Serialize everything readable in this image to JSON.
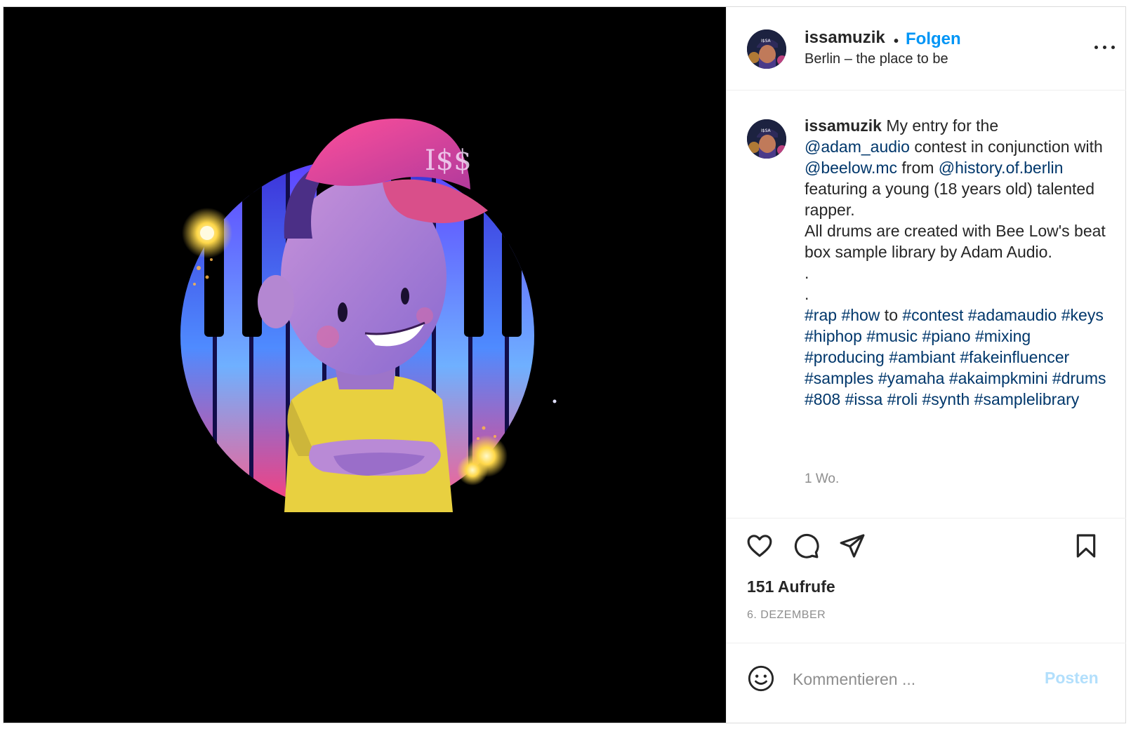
{
  "header": {
    "username": "issamuzik",
    "separator": "•",
    "follow_label": "Folgen",
    "location": "Berlin – the place to be",
    "more_icon": "more-horizontal-icon"
  },
  "caption": {
    "username": "issamuzik",
    "seg1": " My entry for the ",
    "mention1": "@adam_audio",
    "seg2": " contest in conjunction with ",
    "mention2": "@beelow.mc",
    "seg3": " from ",
    "mention3": "@history.of.berlin",
    "seg4": " featuring a young (18 years old) talented rapper.",
    "line2": "All drums are created with Bee Low's beat box sample library by Adam Audio.",
    "dot1": ".",
    "dot2": ".",
    "tag_rap": "#rap",
    "tag_how": "#how",
    "word_to": " to ",
    "tag_contest": "#contest",
    "tags_rest": [
      "#adamaudio",
      "#keys",
      "#hiphop",
      "#music",
      "#piano",
      "#mixing",
      "#producing",
      "#ambiant",
      "#fakeinfluencer",
      "#samples",
      "#yamaha",
      "#akaimpkmini",
      "#drums",
      "#808",
      "#issa",
      "#roli",
      "#synth",
      "#samplelibrary"
    ],
    "time_ago": "1 Wo."
  },
  "actions": {
    "like_icon": "heart-icon",
    "comment_icon": "comment-icon",
    "share_icon": "paper-plane-icon",
    "save_icon": "bookmark-icon"
  },
  "stats": {
    "views": "151 Aufrufe",
    "date": "6. DEZEMBER"
  },
  "comment": {
    "emoji_icon": "smiley-icon",
    "placeholder": "Kommentieren ...",
    "post_label": "Posten"
  },
  "media": {
    "cap_text": "I$$",
    "avatar_cap_text": "I$SA"
  },
  "colors": {
    "link": "#00376b",
    "follow": "#0095f6",
    "post_disabled": "#b2dffc",
    "muted": "#8e8e8e"
  }
}
